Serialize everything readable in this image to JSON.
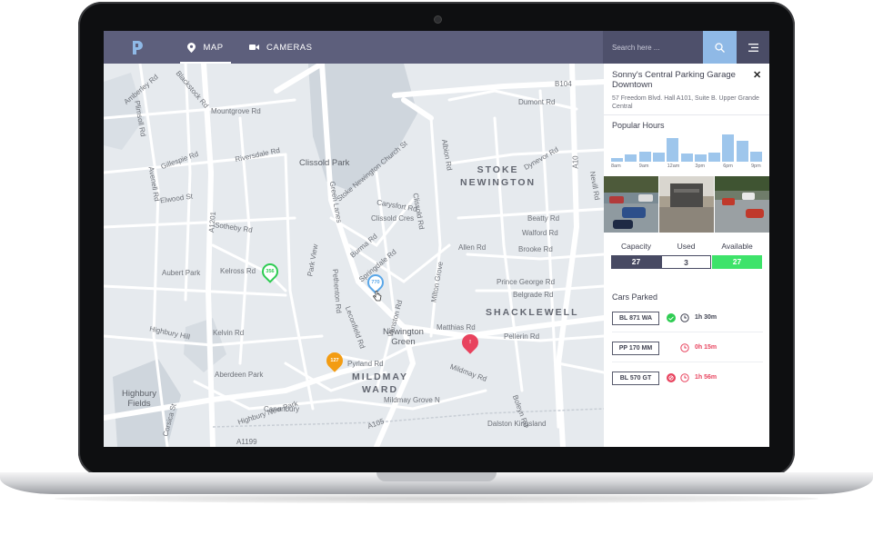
{
  "nav": {
    "tabs": [
      {
        "label": "MAP",
        "icon": "map-pin-icon",
        "active": true
      },
      {
        "label": "CAMERAS",
        "icon": "video-camera-icon",
        "active": false
      }
    ],
    "search_placeholder": "Search here ...",
    "search_icon": "search-icon",
    "menu_icon": "hamburger-menu-icon"
  },
  "map": {
    "labels": {
      "clissold_park": "Clissold Park",
      "stoke_newington": "STOKE\nNEWINGTON",
      "shacklewell": "SHACKLEWELL",
      "newington_green": "Newington\nGreen",
      "mildmay_ward": "MILDMAY\nWARD",
      "highbury_fields": "Highbury\nFields",
      "mountgrove": "Mountgrove Rd",
      "riversdale": "Riversdale Rd",
      "gillespie": "Gillespie Rd",
      "elwood": "Elwood St",
      "sotheby": "Sotheby Rd",
      "aubert": "Aubert Park",
      "kelross": "Kelross Rd",
      "highbury_hill": "Highbury Hill",
      "kelvin": "Kelvin Rd",
      "aberdeen": "Aberdeen Park",
      "highbury_new_park": "Highbury New Park",
      "green_lanes": "Green Lanes",
      "carysfort": "Carysfort Rd",
      "clissold_cres": "Clissold Cres",
      "burma": "Burma Rd",
      "springdale": "Springdale Rd",
      "allen": "Allen Rd",
      "beatty": "Beatty Rd",
      "walford": "Walford Rd",
      "brooke": "Brooke Rd",
      "prince_george": "Prince George Rd",
      "belgrade": "Belgrade Rd",
      "matthias": "Matthias Rd",
      "pellerin": "Pellerin Rd",
      "pyrland": "Pyrland Rd",
      "mildmay_rd": "Mildmay Rd",
      "mildmay_grove": "Mildmay Grove N",
      "dalston": "Dalston Kingsland",
      "canonbury": "Canonbury",
      "dumont": "Dumont Rd",
      "dynevor": "Dynevor Rd",
      "nevill": "Nevill Rd",
      "albion": "Albion Rd",
      "b104": "B104",
      "a10": "A10",
      "a1201": "A1201",
      "a105": "A105",
      "a1199": "A1199",
      "amberley": "Amberley Rd",
      "blackstock": "Blackstock Rd",
      "avenell": "Avenell Rd",
      "plimsoll": "Plimsoll Rd",
      "church_st": "Stoke Newington Church St",
      "pethenton": "Pethenton Rd",
      "park_view": "Park View",
      "winston": "Winston Rd",
      "milton": "Milton Grove",
      "leconfield": "Leconfield Rd",
      "boleyn": "Boleyn Rd",
      "corsica": "Corsica St",
      "clissold_rd": "Clissold Rd"
    },
    "markers": [
      {
        "label": "356",
        "color": "#2ecc52",
        "icon": "parking-marker-icon"
      },
      {
        "label": "770",
        "color": "#5aa7e8",
        "icon": "parking-marker-icon"
      },
      {
        "label": "127",
        "color": "#f39c12",
        "icon": "parking-marker-icon"
      },
      {
        "label": "!",
        "color": "#e8435e",
        "icon": "alert-marker-icon"
      }
    ]
  },
  "panel": {
    "title": "Sonny's Central Parking Garage Downtown",
    "address": "57 Freedom Blvd. Hall A101, Suite B. Upper Grande Central",
    "close_icon": "close-icon",
    "popular_hours": {
      "heading": "Popular Hours",
      "values": [
        0.12,
        0.28,
        0.35,
        0.32,
        0.85,
        0.3,
        0.28,
        0.32,
        1.0,
        0.78,
        0.35
      ],
      "ticks": [
        "8am",
        "9am",
        "12am",
        "3pm",
        "6pm",
        "9pm"
      ]
    },
    "photos": [
      "parking-photo-1",
      "parking-photo-2",
      "parking-photo-3"
    ],
    "stats": {
      "capacity": {
        "label": "Capacity",
        "value": "27"
      },
      "used": {
        "label": "Used",
        "value": "3"
      },
      "available": {
        "label": "Available",
        "value": "27"
      }
    },
    "cars_heading": "Cars Parked",
    "cars": [
      {
        "plate": "BL 871 WA",
        "time": "1h 30m",
        "status_icon": "check-badge-icon",
        "status_color": "#2ecc52",
        "time_color": "#3f4150"
      },
      {
        "plate": "PP 170 MM",
        "time": "0h 15m",
        "status_icon": "",
        "status_color": "",
        "time_color": "#e8435e"
      },
      {
        "plate": "BL 570 GT",
        "time": "1h 56m",
        "status_icon": "blocked-badge-icon",
        "status_color": "#e8435e",
        "time_color": "#e8435e"
      }
    ],
    "colors": {
      "accent": "#5d5f7c",
      "available": "#3ee36a",
      "alert": "#e8435e",
      "chart": "#9ec6ec"
    }
  }
}
